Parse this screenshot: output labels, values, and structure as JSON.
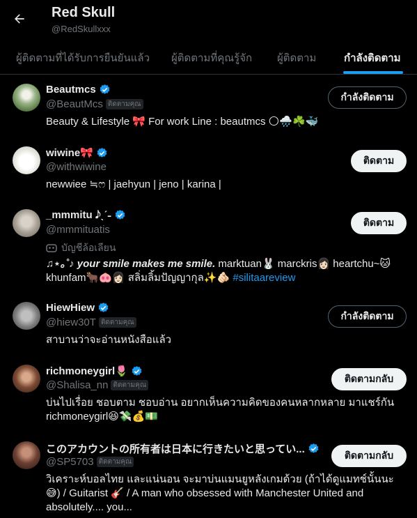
{
  "header": {
    "title": "Red Skull",
    "handle": "@RedSkullxxx"
  },
  "tabs": [
    {
      "label": "ผู้ติดตามที่ได้รับการยืนยันแล้ว",
      "active": false
    },
    {
      "label": "ผู้ติดตามที่คุณรู้จัก",
      "active": false
    },
    {
      "label": "ผู้ติดตาม",
      "active": false
    },
    {
      "label": "กำลังติดตาม",
      "active": true
    }
  ],
  "users": [
    {
      "name": "Beautmcs",
      "handle": "@BeautMcs",
      "follows_you_badge": "ติดตามคุณ",
      "bio": "Beauty & Lifestyle 🎀 For work Line : beautmcs 🌕🌧️☘️🐳",
      "button": "กำลังติดตาม"
    },
    {
      "name": "wiwine🎀",
      "handle": "@withwiwine",
      "bio": "newwiee ≒ෆ | jaehyun | jeno | karina |",
      "button": "ติดตาม"
    },
    {
      "name": "_mmmitu 𝅘𝅥𝅮ˎˊ˗",
      "handle": "@mmmituatis",
      "parody_label": "บัญชีล้อเลียน",
      "bio_lead": "♫⋆｡˚♪ your smile makes me smile.",
      "bio_rest": " marktuan🐰 marckris👩🏻 heartchu~🐱 khunfam🐂🐽👩🏻 สลิ่มลิ้มปัญญากุล✨🫵🏻 ",
      "bio_hashtag": "#silitaareview",
      "button": "ติดตาม"
    },
    {
      "name": "HiewHiew",
      "handle": "@hiew30T",
      "follows_you_badge": "ติดตามคุณ",
      "bio": "สาบานว่าจะอ่านหนังสือแล้ว",
      "button": "กำลังติดตาม"
    },
    {
      "name": "richmoneygirl🌷",
      "handle": "@Shalisa_nn",
      "follows_you_badge": "ติดตามคุณ",
      "bio": "บ่นไปเรื่อย ชอบตาม ชอบอ่าน อยากเห็นความคิดของคนหลากหลาย มาแชร์กัน richmoneygirl😆💸💰💵",
      "button": "ติดตามกลับ"
    },
    {
      "name": "このアカウントの所有者は日本に行きたいと思ってい...",
      "handle": "@SP5703",
      "follows_you_badge": "ติดตามคุณ",
      "bio": "วิเคราะห์บอลไทย และแน่นอน จะมาบ่นแมนยูหลังเกมด้วย (ถ้าได้ดูแมทช์นั้นนะ😅) / Guitarist 🎸 / A man who obsessed with Manchester United and absolutely.... you...",
      "button": "ติดตามกลับ"
    }
  ],
  "colors": {
    "background": "#000000",
    "accent": "#1d9bf0",
    "secondary_text": "#71767b"
  }
}
